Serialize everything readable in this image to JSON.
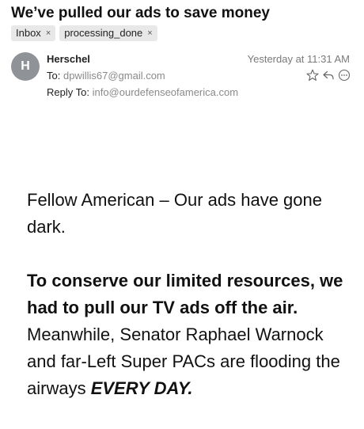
{
  "email": {
    "subject": "We’ve pulled our ads to save money",
    "labels": [
      {
        "name": "Inbox",
        "remove": "×"
      },
      {
        "name": "processing_done",
        "remove": "×"
      }
    ],
    "sender": {
      "initial": "H",
      "name": "Herschel"
    },
    "timestamp": "Yesterday at 11:31 AM",
    "to_label": "To:",
    "to_value": "dpwillis67@gmail.com",
    "reply_to_label": "Reply To:",
    "reply_to_value": "info@ourdefenseofamerica.com",
    "actions": [
      "star-icon",
      "reply-icon",
      "more-options-icon"
    ]
  },
  "body": {
    "p1": "Fellow American – Our ads have gone dark.",
    "p2_bold": "To conserve our limited resources, we had to pull our TV ads off the air.",
    "p2_rest": " Meanwhile, Senator Raphael Warnock and far-Left Super PACs are flooding the airways ",
    "p2_emph": "EVERY DAY."
  }
}
